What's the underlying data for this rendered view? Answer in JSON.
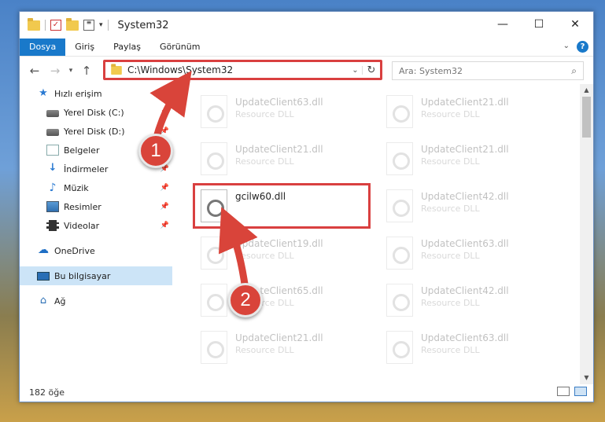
{
  "window": {
    "title": "System32",
    "controls": {
      "minimize": "—",
      "maximize": "☐",
      "close": "✕"
    }
  },
  "ribbon": {
    "tabs": [
      "Dosya",
      "Giriş",
      "Paylaş",
      "Görünüm"
    ],
    "help": "?"
  },
  "address": {
    "path": "C:\\Windows\\System32",
    "search_placeholder": "Ara: System32"
  },
  "sidebar": {
    "items": [
      {
        "label": "Hızlı erişim",
        "icon": "star-icon",
        "level": 0
      },
      {
        "label": "Yerel Disk (C:)",
        "icon": "disk-icon",
        "level": 1
      },
      {
        "label": "Yerel Disk (D:)",
        "icon": "disk-icon",
        "level": 1
      },
      {
        "label": "Belgeler",
        "icon": "documents-icon",
        "level": 1
      },
      {
        "label": "İndirmeler",
        "icon": "downloads-icon",
        "level": 1
      },
      {
        "label": "Müzik",
        "icon": "music-icon",
        "level": 1
      },
      {
        "label": "Resimler",
        "icon": "pictures-icon",
        "level": 1
      },
      {
        "label": "Videolar",
        "icon": "videos-icon",
        "level": 1
      },
      {
        "label": "OneDrive",
        "icon": "onedrive-icon",
        "level": 0
      },
      {
        "label": "Bu bilgisayar",
        "icon": "computer-icon",
        "level": 0,
        "selected": true
      },
      {
        "label": "Ağ",
        "icon": "network-icon",
        "level": 0
      }
    ]
  },
  "files": {
    "col1": [
      {
        "name": "UpdateClient63.dll",
        "type": "Resource DLL"
      },
      {
        "name": "UpdateClient21.dll",
        "type": "Resource DLL"
      },
      {
        "name": "gcilw60.dll",
        "type": ""
      },
      {
        "name": "UpdateClient19.dll",
        "type": "Resource DLL"
      },
      {
        "name": "UpdateClient65.dll",
        "type": "Resource DLL"
      },
      {
        "name": "UpdateClient21.dll",
        "type": "Resource DLL"
      }
    ],
    "col2": [
      {
        "name": "UpdateClient21.dll",
        "type": "Resource DLL"
      },
      {
        "name": "UpdateClient21.dll",
        "type": "Resource DLL"
      },
      {
        "name": "UpdateClient42.dll",
        "type": "Resource DLL"
      },
      {
        "name": "UpdateClient63.dll",
        "type": "Resource DLL"
      },
      {
        "name": "UpdateClient42.dll",
        "type": "Resource DLL"
      },
      {
        "name": "UpdateClient63.dll",
        "type": "Resource DLL"
      }
    ]
  },
  "status": {
    "count": "182 öğe"
  },
  "annotations": {
    "step1": "1",
    "step2": "2",
    "color": "#d9443a"
  }
}
